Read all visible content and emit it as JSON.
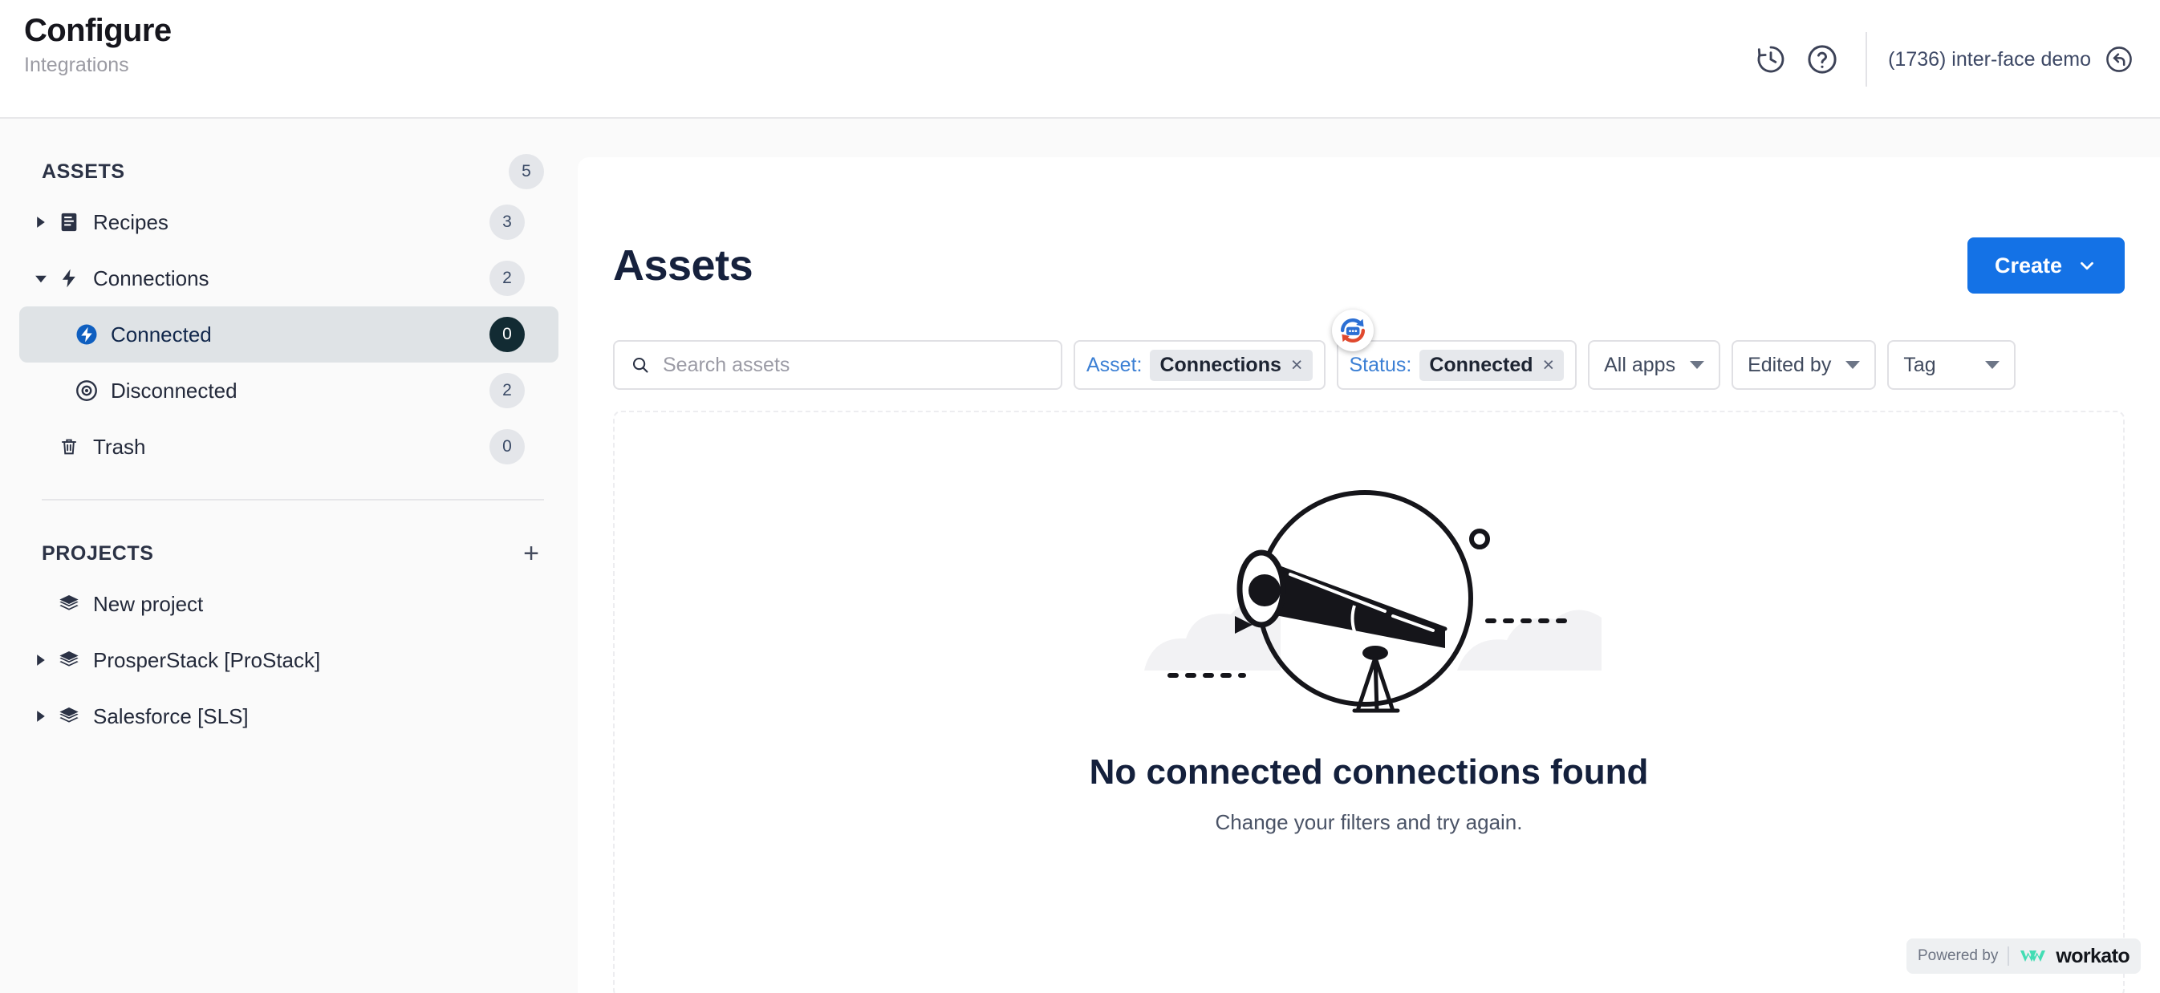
{
  "header": {
    "title": "Configure",
    "subtitle": "Integrations",
    "history_icon": "clock-history-icon",
    "help_icon": "question-circle-icon",
    "account_name": "(1736) inter-face demo",
    "account_icon": "return-arrow-icon"
  },
  "sidebar": {
    "assets": {
      "title": "ASSETS",
      "count": "5",
      "items": [
        {
          "label": "Recipes",
          "count": "3",
          "icon": "recipes-icon",
          "caret": "right",
          "level": 1,
          "active": false
        },
        {
          "label": "Connections",
          "count": "2",
          "icon": "lightning-icon",
          "caret": "down",
          "level": 1,
          "active": false
        },
        {
          "label": "Connected",
          "count": "0",
          "icon": "connected-icon",
          "caret": "none",
          "level": 2,
          "active": true
        },
        {
          "label": "Disconnected",
          "count": "2",
          "icon": "disconnected-icon",
          "caret": "none",
          "level": 2,
          "active": false
        },
        {
          "label": "Trash",
          "count": "0",
          "icon": "trash-icon",
          "caret": "none",
          "level": 1,
          "active": false
        }
      ]
    },
    "projects": {
      "title": "PROJECTS",
      "add_label": "+",
      "items": [
        {
          "label": "New project",
          "icon": "layers-icon",
          "caret": "none"
        },
        {
          "label": "ProsperStack [ProStack]",
          "icon": "layers-icon",
          "caret": "right"
        },
        {
          "label": "Salesforce [SLS]",
          "icon": "layers-icon",
          "caret": "right"
        }
      ]
    }
  },
  "main": {
    "page_title": "Assets",
    "create_label": "Create",
    "search": {
      "placeholder": "Search assets",
      "value": ""
    },
    "filters": [
      {
        "key": "Asset:",
        "value": "Connections",
        "remove": "×"
      },
      {
        "key": "Status:",
        "value": "Connected",
        "remove": "×"
      }
    ],
    "dropdowns": [
      {
        "label": "All apps"
      },
      {
        "label": "Edited by"
      },
      {
        "label": "Tag"
      }
    ],
    "empty_state": {
      "title": "No connected connections found",
      "subtitle": "Change your filters and try again.",
      "illustration": "telescope-illustration"
    }
  },
  "footer": {
    "powered_label": "Powered by",
    "brand": "workato"
  },
  "colors": {
    "accent_blue": "#1472e6",
    "chip_key_blue": "#3b7fd4",
    "active_bg": "#dfe3e6",
    "badge_dark": "#122b33",
    "workato_teal": "#43ddb4"
  }
}
